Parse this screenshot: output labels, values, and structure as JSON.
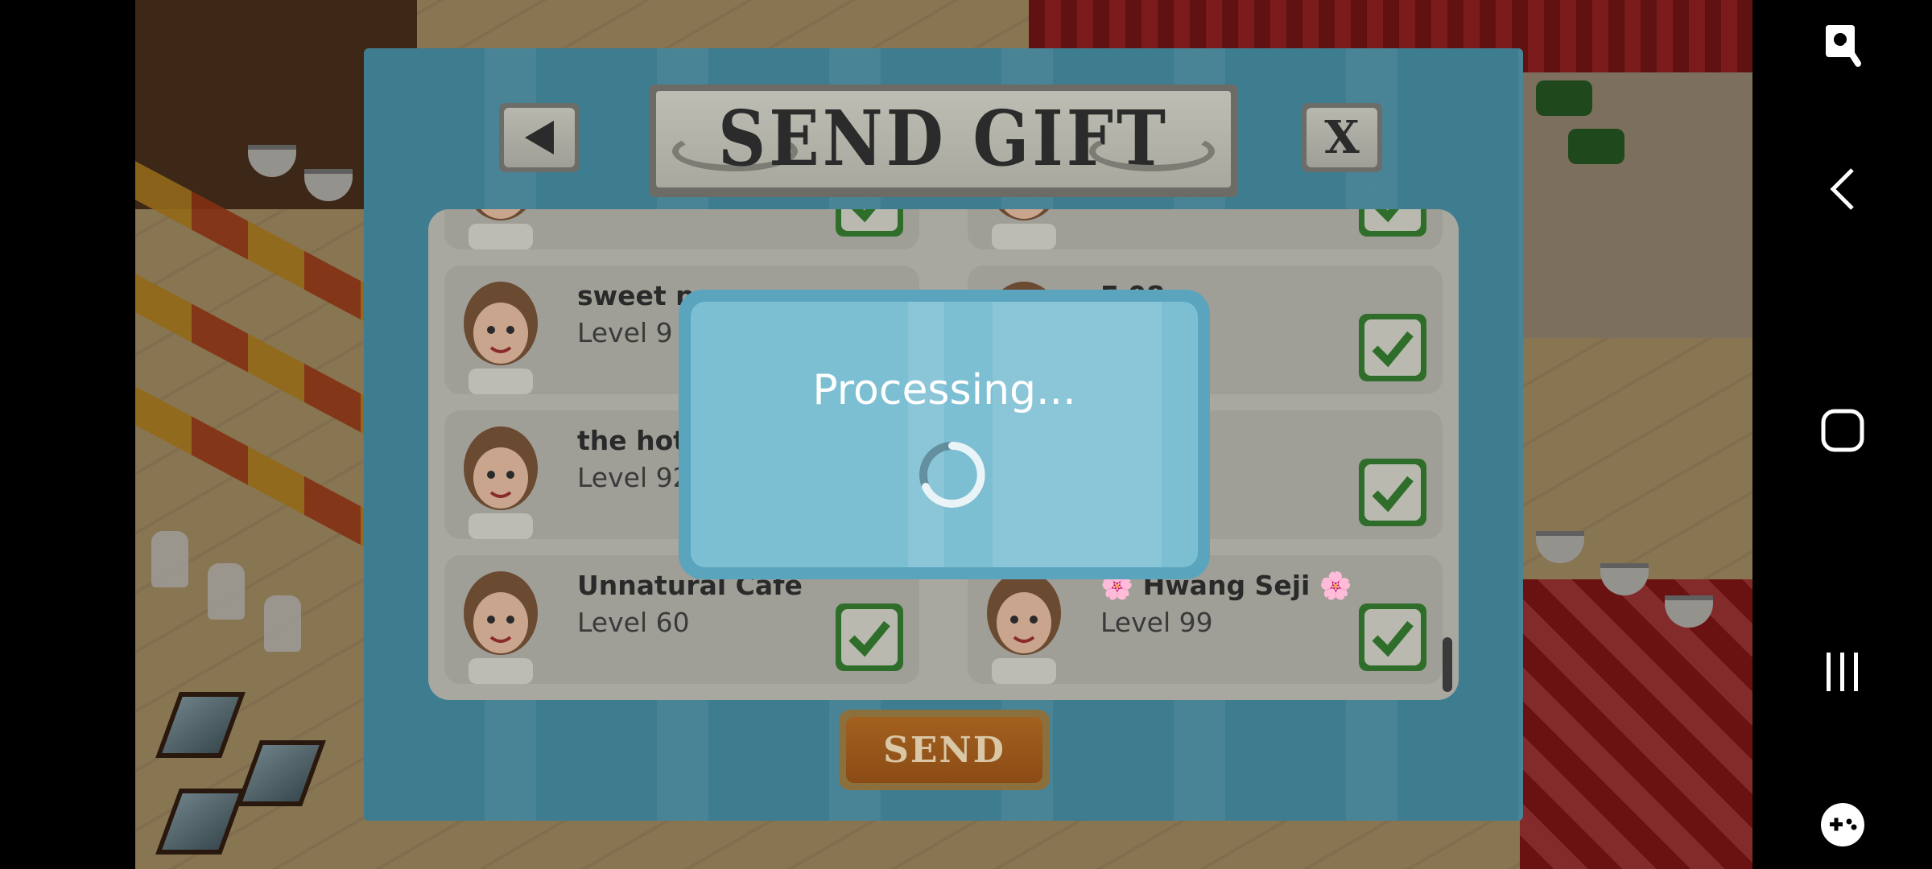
{
  "dialog": {
    "title": "SEND GIFT",
    "send_label": "SEND",
    "close_label": "X",
    "back_icon": "back-arrow-icon"
  },
  "friends": [
    {
      "name": "",
      "level": ""
    },
    {
      "name": "",
      "level": ""
    },
    {
      "name": "sweet n",
      "level": "Level 9"
    },
    {
      "name": "F    08",
      "level": ""
    },
    {
      "name": "the hot",
      "level": "Level 92"
    },
    {
      "name": "",
      "level": ""
    },
    {
      "name": "Unnatural Cafe",
      "level": "Level 60"
    },
    {
      "name": "🌸 Hwang Seji 🌸",
      "level": "Level 99"
    }
  ],
  "processing": {
    "message": "Processing..."
  },
  "navbar": {
    "icons": [
      "accessibility-icon",
      "back-icon",
      "home-icon",
      "recents-icon",
      "game-launcher-icon"
    ]
  },
  "colors": {
    "dialog": "#3e7c90",
    "modal": "#7cbfd3",
    "checkbox": "#2f6e2a",
    "send_button": "#a3611f"
  }
}
